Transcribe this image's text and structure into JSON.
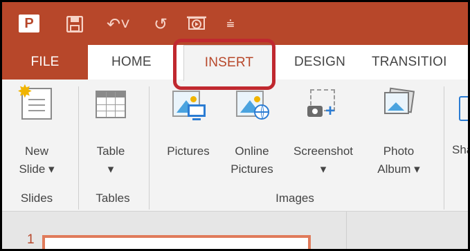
{
  "qat": {
    "app_icon": "powerpoint-icon",
    "app_letter": "P",
    "save_icon": "save-icon",
    "undo_icon": "undo-icon",
    "redo_icon": "redo-icon",
    "startshow_icon": "start-from-beginning-icon",
    "customize_icon": "customize-qat-icon",
    "undo_glyph": "↶˅",
    "redo_glyph": "↺",
    "customize_glyph": "⩧"
  },
  "tabs": [
    {
      "label": "FILE"
    },
    {
      "label": "HOME"
    },
    {
      "label": "INSERT"
    },
    {
      "label": "DESIGN"
    },
    {
      "label": "TRANSITIOI"
    }
  ],
  "ribbon": {
    "slides_group": {
      "label": "Slides",
      "new_slide": {
        "line1": "New",
        "line2": "Slide ▾"
      }
    },
    "tables_group": {
      "label": "Tables",
      "table": {
        "line1": "Table",
        "line2": "▾"
      }
    },
    "images_group": {
      "label": "Images",
      "pictures": {
        "line1": "Pictures"
      },
      "online_pictures": {
        "line1": "Online",
        "line2": "Pictures"
      },
      "screenshot": {
        "line1": "Screenshot",
        "line2": "▾"
      },
      "photo_album": {
        "line1": "Photo",
        "line2": "Album ▾"
      }
    },
    "shapes_partial": {
      "line1": "Sha"
    }
  },
  "slide_pane": {
    "number": "1"
  },
  "colors": {
    "accent": "#b7472a",
    "highlight": "#c0282f",
    "ribbon_bg": "#f3f3f3"
  }
}
